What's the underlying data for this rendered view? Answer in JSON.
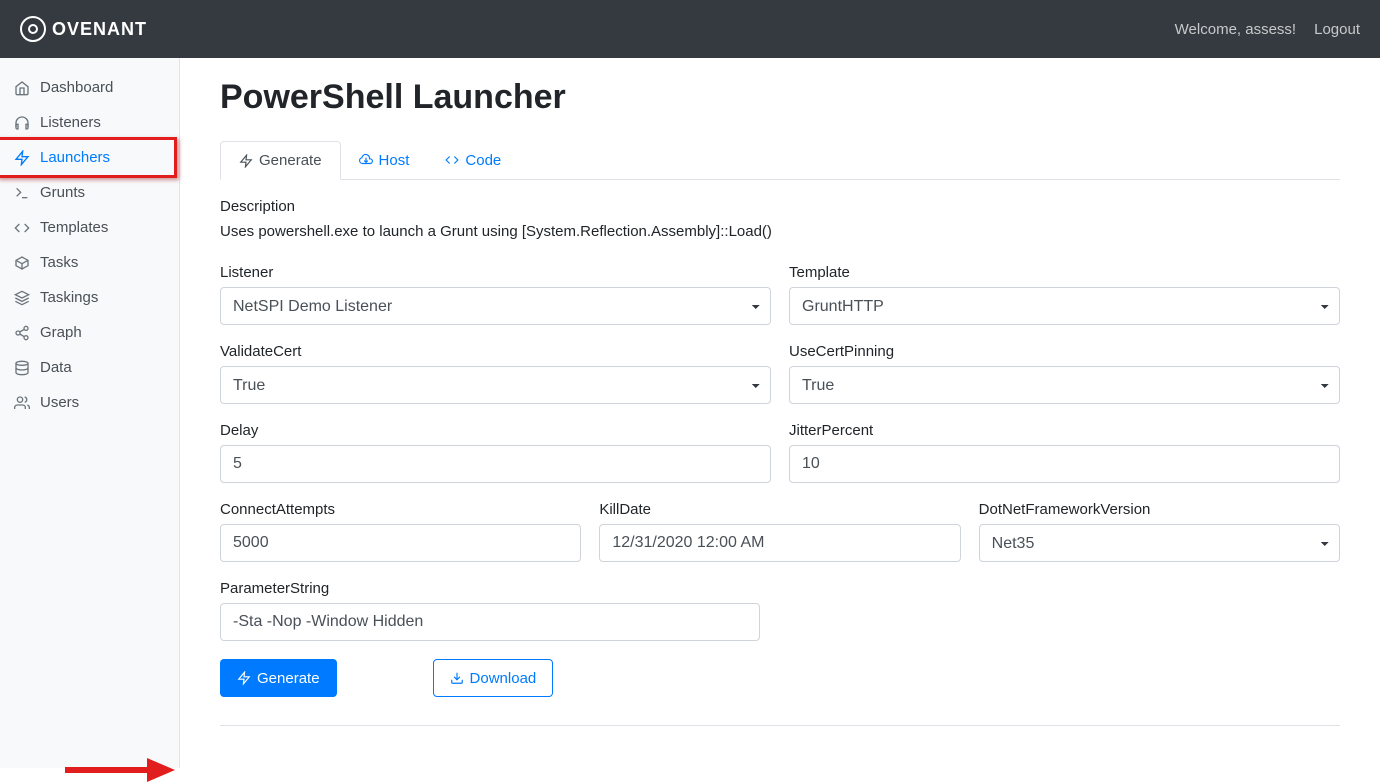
{
  "brand": "OVENANT",
  "header": {
    "welcome": "Welcome, assess!",
    "logout": "Logout"
  },
  "sidebar": {
    "items": [
      {
        "label": "Dashboard"
      },
      {
        "label": "Listeners"
      },
      {
        "label": "Launchers"
      },
      {
        "label": "Grunts"
      },
      {
        "label": "Templates"
      },
      {
        "label": "Tasks"
      },
      {
        "label": "Taskings"
      },
      {
        "label": "Graph"
      },
      {
        "label": "Data"
      },
      {
        "label": "Users"
      }
    ]
  },
  "page": {
    "title": "PowerShell Launcher",
    "tabs": {
      "generate": "Generate",
      "host": "Host",
      "code": "Code"
    },
    "description_label": "Description",
    "description": "Uses powershell.exe to launch a Grunt using [System.Reflection.Assembly]::Load()",
    "fields": {
      "listener": {
        "label": "Listener",
        "value": "NetSPI Demo Listener"
      },
      "template": {
        "label": "Template",
        "value": "GruntHTTP"
      },
      "validate_cert": {
        "label": "ValidateCert",
        "value": "True"
      },
      "use_cert_pinning": {
        "label": "UseCertPinning",
        "value": "True"
      },
      "delay": {
        "label": "Delay",
        "value": "5"
      },
      "jitter": {
        "label": "JitterPercent",
        "value": "10"
      },
      "connect_attempts": {
        "label": "ConnectAttempts",
        "value": "5000"
      },
      "kill_date": {
        "label": "KillDate",
        "value": "12/31/2020 12:00 AM"
      },
      "dotnet": {
        "label": "DotNetFrameworkVersion",
        "value": "Net35"
      },
      "param_string": {
        "label": "ParameterString",
        "value": "-Sta -Nop -Window Hidden"
      }
    },
    "buttons": {
      "generate": "Generate",
      "download": "Download"
    }
  }
}
